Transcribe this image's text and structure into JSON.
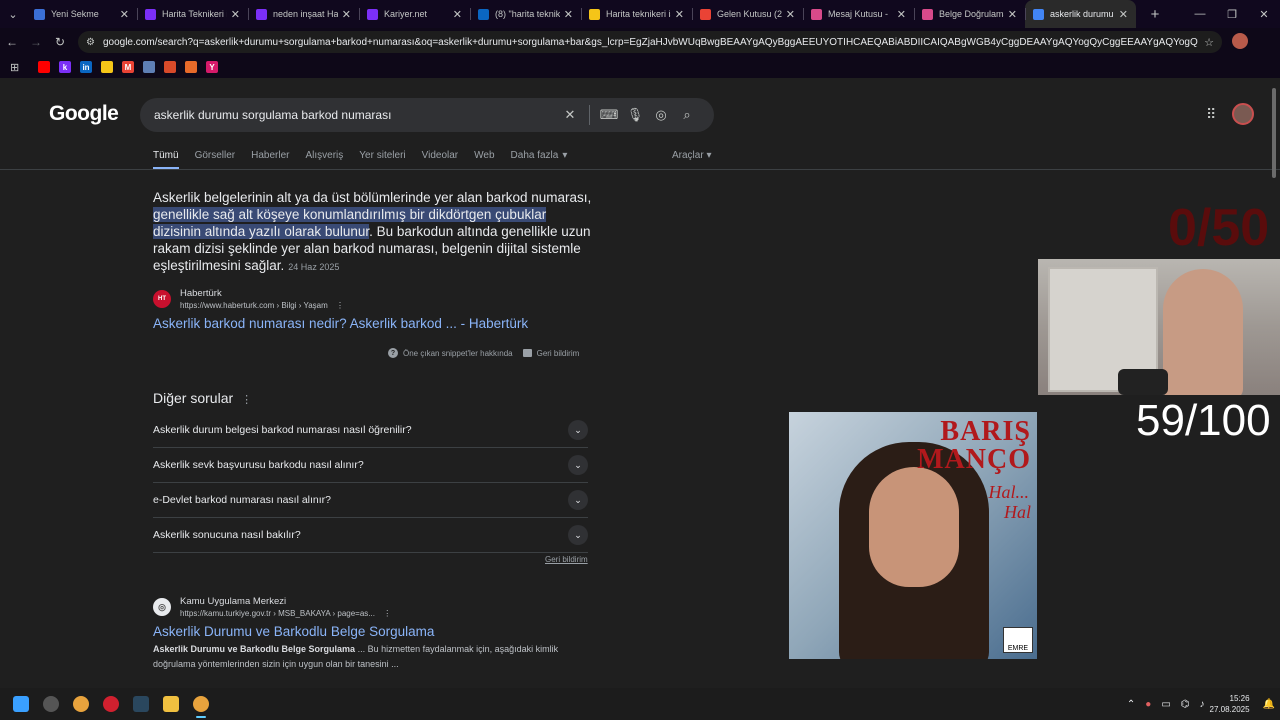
{
  "browser": {
    "tabs": [
      {
        "title": "Yeni Sekme",
        "icon": "globe-icon",
        "color": "#3b6fd6",
        "active": false
      },
      {
        "title": "Harita Teknikeri iş",
        "icon": "k-icon",
        "color": "#7b2ff7",
        "active": false
      },
      {
        "title": "neden inşaat Hari",
        "icon": "k-icon",
        "color": "#7b2ff7",
        "active": false
      },
      {
        "title": "Kariyer.net",
        "icon": "k-icon",
        "color": "#7b2ff7",
        "active": false
      },
      {
        "title": "(8) \"harita teknike",
        "icon": "linkedin-icon",
        "color": "#0a66c2",
        "active": false
      },
      {
        "title": "Harita teknikeri iş",
        "icon": "flag-icon",
        "color": "#f5c518",
        "active": false
      },
      {
        "title": "Gelen Kutusu (21)",
        "icon": "gmail-icon",
        "color": "#ea4335",
        "active": false
      },
      {
        "title": "Mesaj Kutusu -",
        "icon": "mail-icon",
        "color": "#d84a8a",
        "active": false
      },
      {
        "title": "Belge Doğrulama",
        "icon": "doc-icon",
        "color": "#d84a8a",
        "active": false
      },
      {
        "title": "askerlik durumu s",
        "icon": "google-icon",
        "color": "#4285f4",
        "active": true
      }
    ],
    "url": "google.com/search?q=askerlik+durumu+sorgulama+barkod+numarası&oq=askerlik+durumu+sorgulama+bar&gs_lcrp=EgZjaHJvbWUqBwgBEAAYgAQyBggAEEUYOTIHCAEQABiABDIICAIQABgWGB4yCggDEAAYgAQYogQyCggEEAAYgAQYogQyCggFEAAYogQYiQUy..."
  },
  "bookmarks": [
    {
      "icon": "youtube-icon",
      "color": "#ff0000",
      "label": ""
    },
    {
      "icon": "k-icon",
      "color": "#7b2ff7",
      "label": "k"
    },
    {
      "icon": "linkedin-icon",
      "color": "#0a66c2",
      "label": "in"
    },
    {
      "icon": "flag-icon",
      "color": "#f5c518",
      "label": ""
    },
    {
      "icon": "gmail-icon",
      "color": "#ea4335",
      "label": "M"
    },
    {
      "icon": "doc-icon",
      "color": "#5f7fb5",
      "label": ""
    },
    {
      "icon": "circle-icon",
      "color": "#d84a2a",
      "label": ""
    },
    {
      "icon": "box-icon",
      "color": "#e86a2a",
      "label": ""
    },
    {
      "icon": "y-icon",
      "color": "#d61a6a",
      "label": "Y"
    }
  ],
  "google": {
    "logo": "Google",
    "query": "askerlik durumu sorgulama barkod numarası",
    "nav_tabs": [
      "Tümü",
      "Görseller",
      "Haberler",
      "Alışveriş",
      "Yer siteleri",
      "Videolar",
      "Web",
      "Daha fazla"
    ],
    "tools": "Araçlar",
    "snippet": {
      "part1": "Askerlik belgelerinin alt ya da üst bölümlerinde yer alan barkod numarası, ",
      "highlight": "genellikle sağ alt köşeye konumlandırılmış bir dikdörtgen çubuklar dizisinin altında yazılı olarak bulunur",
      "part2": ". Bu barkodun altında genellikle uzun rakam dizisi şeklinde yer alan barkod numarası, belgenin dijital sistemle eşleştirilmesini sağlar.",
      "date": "24 Haz 2025"
    },
    "result1": {
      "source": "Habertürk",
      "url": "https://www.haberturk.com › Bilgi › Yaşam",
      "title": "Askerlik barkod numarası nedir? Askerlik barkod ... - Habertürk"
    },
    "snippet_about": "Öne çıkan snippet'ler hakkında",
    "feedback": "Geri bildirim",
    "paa": {
      "title": "Diğer sorular",
      "items": [
        "Askerlik durum belgesi barkod numarası nasıl öğrenilir?",
        "Askerlik sevk başvurusu barkodu nasıl alınır?",
        "e-Devlet barkod numarası nasıl alınır?",
        "Askerlik sonucuna nasıl bakılır?"
      ],
      "feedback": "Geri bildirim"
    },
    "result2": {
      "source": "Kamu Uygulama Merkezi",
      "url": "https://kamu.turkiye.gov.tr › MSB_BAKAYA › page=as...",
      "title": "Askerlik Durumu ve Barkodlu Belge Sorgulama",
      "desc_bold": "Askerlik Durumu ve Barkodlu Belge Sorgulama",
      "desc": " ... Bu hizmetten faydalanmak için, aşağıdaki kimlik doğrulama yöntemlerinden sizin için uygun olan bir tanesini ..."
    }
  },
  "overlay": {
    "counter_red": "0/50",
    "counter_white": "59/100",
    "album_title1": "BARIŞ",
    "album_title2": "MANÇO",
    "album_subtitle1": "Hal...",
    "album_subtitle2": "Hal",
    "album_label": "EMRE"
  },
  "taskbar": {
    "time": "15:26",
    "date": "27.08.2025"
  }
}
